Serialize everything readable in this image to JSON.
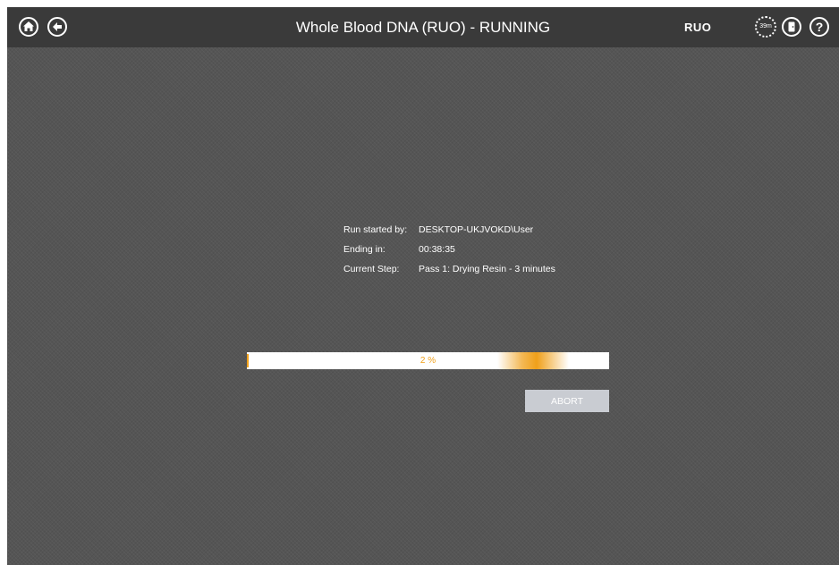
{
  "header": {
    "title": "Whole Blood DNA (RUO) - RUNNING",
    "mode_badge": "RUO",
    "timer_label": "39m",
    "icons": [
      "home-icon",
      "back-arrow-icon",
      "timer-icon",
      "exit-door-icon",
      "help-icon"
    ]
  },
  "run_info": {
    "started_by_label": "Run started by:",
    "started_by_value": "DESKTOP-UKJVOKD\\User",
    "ending_label": "Ending in:",
    "ending_value": "00:38:35",
    "step_label": "Current Step:",
    "step_value": "Pass 1: Drying Resin - 3 minutes"
  },
  "progress": {
    "percent": 2,
    "label": "2 %"
  },
  "actions": {
    "abort_label": "ABORT"
  },
  "colors": {
    "accent": "#f0a01a",
    "topbar": "#3a3a3a",
    "background": "#555555",
    "abort_button": "#c9ccd2"
  }
}
